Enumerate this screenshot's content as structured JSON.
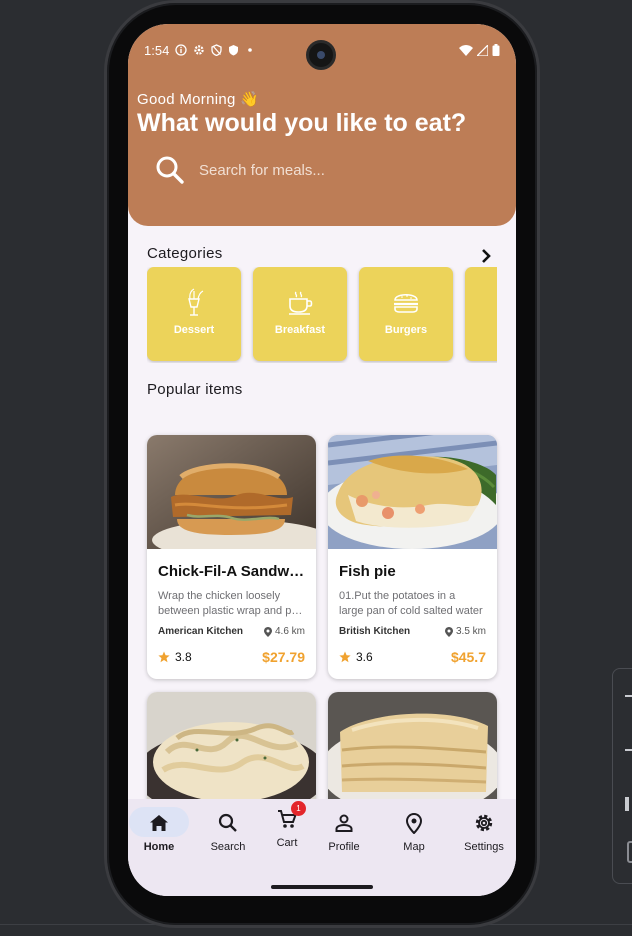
{
  "status_bar": {
    "time": "1:54"
  },
  "header": {
    "greeting": "Good Morning 👋",
    "headline": "What would you like to eat?",
    "search_placeholder": "Search for meals..."
  },
  "categories": {
    "title": "Categories",
    "items": [
      {
        "label": "Dessert",
        "icon": "dessert-icon"
      },
      {
        "label": "Breakfast",
        "icon": "coffee-cup-icon"
      },
      {
        "label": "Burgers",
        "icon": "burger-icon"
      }
    ]
  },
  "popular": {
    "title": "Popular items",
    "items": [
      {
        "name": "Chick-Fil-A Sandwich",
        "desc1": "Wrap the chicken loosely",
        "desc2": "between plastic wrap and pound",
        "kitchen": "American Kitchen",
        "distance": "4.6 km",
        "rating": "3.8",
        "price": "$27.79"
      },
      {
        "name": "Fish pie",
        "desc1": "01.Put the potatoes in a",
        "desc2": "large pan of cold salted water",
        "kitchen": "British Kitchen",
        "distance": "3.5 km",
        "rating": "3.6",
        "price": "$45.7"
      }
    ]
  },
  "nav": {
    "items": [
      {
        "label": "Home",
        "icon": "home-icon",
        "active": true
      },
      {
        "label": "Search",
        "icon": "search-icon"
      },
      {
        "label": "Cart",
        "icon": "cart-icon",
        "badge": "1"
      },
      {
        "label": "Profile",
        "icon": "person-icon"
      },
      {
        "label": "Map",
        "icon": "location-pin-icon"
      },
      {
        "label": "Settings",
        "icon": "gear-icon"
      }
    ]
  },
  "colors": {
    "header": "#bd7d56",
    "category_tile": "#ecd35a",
    "price": "#f0a22f",
    "rating_star": "#f0a22f",
    "nav_active": "#dde3f5",
    "badge": "#e3262b"
  }
}
